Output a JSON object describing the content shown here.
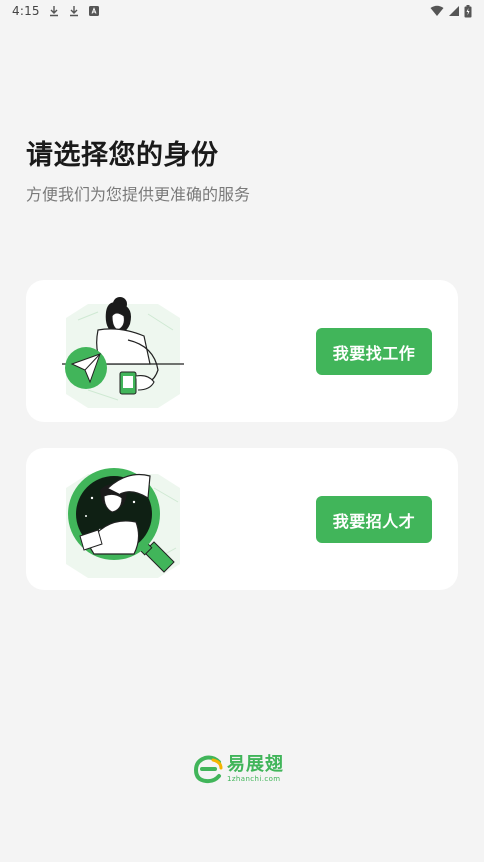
{
  "status_bar": {
    "time": "4:15",
    "icons": [
      "download-icon",
      "download-icon",
      "notification-icon",
      "wifi-icon",
      "signal-icon",
      "battery-icon"
    ]
  },
  "header": {
    "title": "请选择您的身份",
    "subtitle": "方便我们为您提供更准确的服务"
  },
  "cards": {
    "job_seeker": {
      "button_label": "我要找工作",
      "illustration": "job-seeker-illustration"
    },
    "recruiter": {
      "button_label": "我要招人才",
      "illustration": "recruiter-illustration"
    }
  },
  "footer": {
    "logo_name": "易展翅",
    "logo_domain": "1zhanchi.com"
  },
  "colors": {
    "accent": "#41b55a",
    "background": "#f4f4f4",
    "card": "#ffffff"
  }
}
